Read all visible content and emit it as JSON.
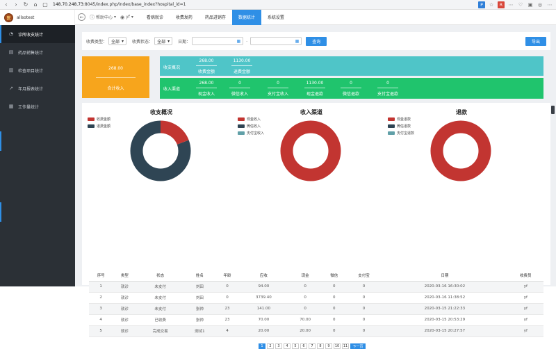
{
  "browser": {
    "url_host": "148.70.248.73",
    "url_rest": ":8045/index.php/index/base_index?hospital_id=1"
  },
  "brand": {
    "name": "allsotest",
    "logo_text": "医"
  },
  "sidebar": {
    "items": [
      {
        "label": "诊所收支统计",
        "icon": "chart-icon"
      },
      {
        "label": "药品销售统计",
        "icon": "box-icon"
      },
      {
        "label": "检查项目统计",
        "icon": "bar-icon"
      },
      {
        "label": "年月报表统计",
        "icon": "trend-icon"
      },
      {
        "label": "工作量统计",
        "icon": "calc-icon"
      }
    ]
  },
  "header": {
    "help": "帮助中心",
    "user": "yf",
    "tabs": [
      "看病就诊",
      "收费发药",
      "药品进销存",
      "数据统计",
      "系统设置"
    ],
    "active_tab": 3
  },
  "filter": {
    "type_label": "收费类型：",
    "type_value": "全部",
    "status_label": "收费状态：",
    "status_value": "全部",
    "date_label": "日期：",
    "date_sep": "-",
    "query_button": "查询",
    "export_button": "导出"
  },
  "summary": {
    "total_value": "268.00",
    "total_label": "合计收入",
    "overview_label": "收支概况",
    "overview": [
      {
        "value": "268.00",
        "label": "收费金额"
      },
      {
        "value": "1130.00",
        "label": "退费金额"
      }
    ],
    "channel_label": "收入渠道",
    "channels": [
      {
        "value": "268.00",
        "label": "现金收入"
      },
      {
        "value": "0",
        "label": "微信收入"
      },
      {
        "value": "0",
        "label": "支付宝收入"
      },
      {
        "value": "1130.00",
        "label": "现金退款"
      },
      {
        "value": "0",
        "label": "微信退款"
      },
      {
        "value": "0",
        "label": "支付宝退款"
      }
    ]
  },
  "charts": [
    {
      "title": "收支概况",
      "legend": [
        "收费金额",
        "退费金额"
      ],
      "colors": [
        "#c23531",
        "#2f4554"
      ],
      "values": [
        268,
        1130
      ]
    },
    {
      "title": "收入渠道",
      "legend": [
        "现金收入",
        "微信收入",
        "支付宝收入"
      ],
      "colors": [
        "#c23531",
        "#2f4554",
        "#61a0a8"
      ],
      "values": [
        268,
        0,
        0
      ]
    },
    {
      "title": "退款",
      "legend": [
        "现金退款",
        "微信退款",
        "支付宝退款"
      ],
      "colors": [
        "#c23531",
        "#2f4554",
        "#61a0a8"
      ],
      "values": [
        1130,
        0,
        0
      ]
    }
  ],
  "table": {
    "headers": [
      "序号",
      "类型",
      "状态",
      "姓名",
      "年龄",
      "应收",
      "现金",
      "微信",
      "支付宝",
      "日期",
      "收费员"
    ],
    "rows": [
      [
        "1",
        "就诊",
        "未支付",
        "刘田",
        "0",
        "94.00",
        "0",
        "0",
        "0",
        "2020-03-16 16:30:02",
        "yf"
      ],
      [
        "2",
        "就诊",
        "未支付",
        "刘田",
        "0",
        "3739.40",
        "0",
        "0",
        "0",
        "2020-03-16 11:38:52",
        "yf"
      ],
      [
        "3",
        "就诊",
        "未支付",
        "张帅",
        "23",
        "141.00",
        "0",
        "0",
        "0",
        "2020-03-15 21:22:33",
        "yf"
      ],
      [
        "4",
        "就诊",
        "已收费",
        "张帅",
        "23",
        "70.00",
        "70.00",
        "0",
        "0",
        "2020-03-15 20:53:29",
        "yf"
      ],
      [
        "5",
        "就诊",
        "完成交易",
        "测试1",
        "4",
        "20.00",
        "20.00",
        "0",
        "0",
        "2020-03-15 20:27:57",
        "yf"
      ]
    ]
  },
  "pagination": {
    "pages": [
      "1",
      "2",
      "3",
      "4",
      "5",
      "6",
      "7",
      "8",
      "9",
      "10",
      "11"
    ],
    "active": 0,
    "next": "下一页"
  }
}
